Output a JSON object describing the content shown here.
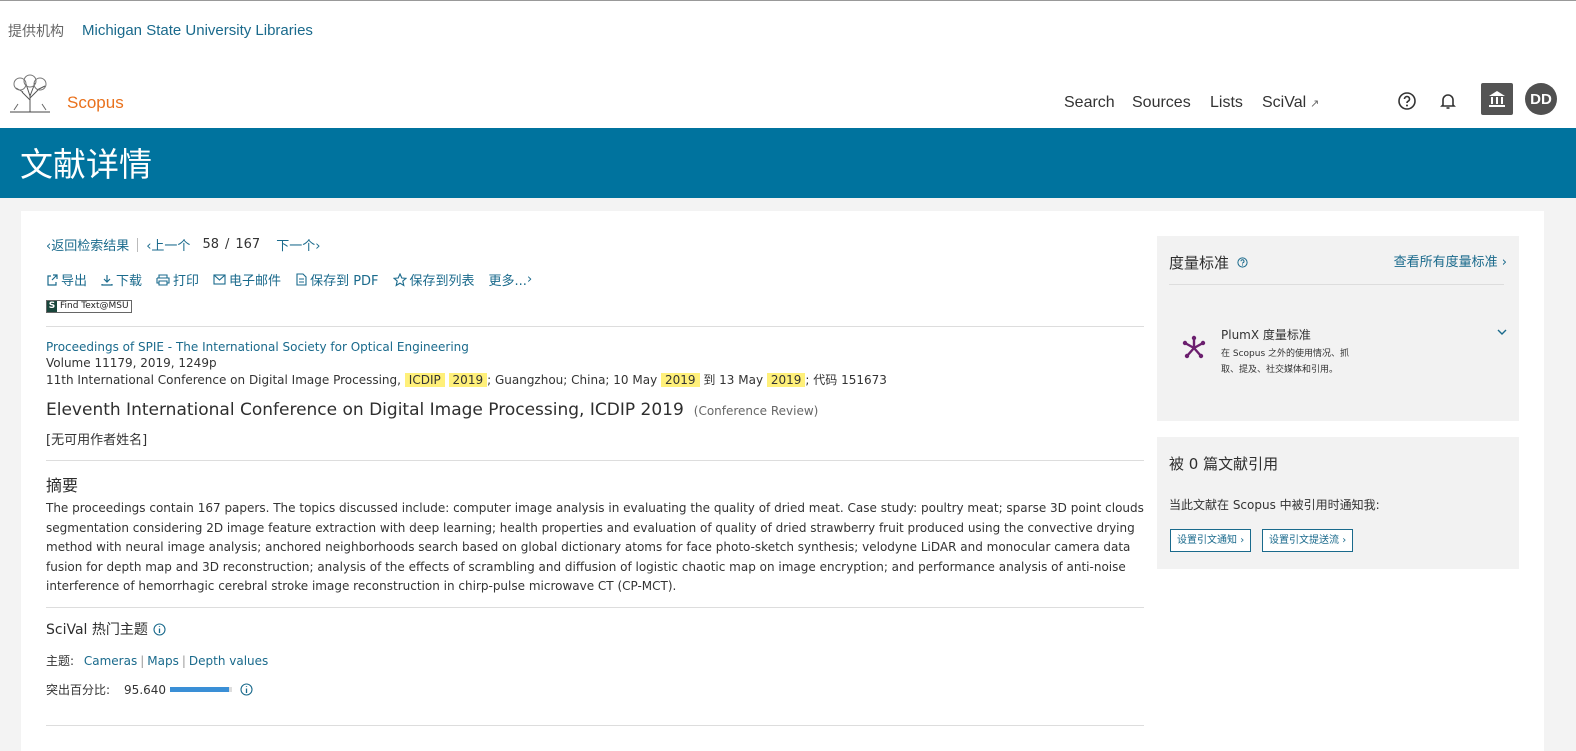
{
  "institution": {
    "label": "提供机构",
    "name": "Michigan State University Libraries"
  },
  "brand": {
    "name": "Scopus",
    "color": "#e9711c"
  },
  "nav": {
    "search": "Search",
    "sources": "Sources",
    "lists": "Lists",
    "scival": "SciVal",
    "scival_ext": "↗"
  },
  "user": {
    "initials": "DD"
  },
  "icons": [
    "help-icon",
    "bell-icon",
    "institution-icon",
    "external-link-icon"
  ],
  "banner": {
    "title": "文献详情",
    "color": "#00739e"
  },
  "pager": {
    "back": "返回检索结果",
    "prev": "上一个",
    "current": "58",
    "slash": "/",
    "total": "167",
    "next": "下一个"
  },
  "actions": {
    "export": "导出",
    "download": "下载",
    "print": "打印",
    "email": "电子邮件",
    "save_pdf": "保存到 PDF",
    "save_list": "保存到列表",
    "more": "更多..."
  },
  "findtext": {
    "s": "S",
    "label": "Find Text@MSU"
  },
  "source": {
    "title": "Proceedings of SPIE - The International Society for Optical Engineering",
    "meta": "Volume 11179, 2019, 1249p",
    "conf_a": "11th International Conference on Digital Image Processing, ",
    "hl_icdip": "ICDIP",
    "hl_2019a": "2019",
    "conf_b": "; Guangzhou; China; 10 May ",
    "hl_2019b": "2019",
    "conf_c": " 到 13 May ",
    "hl_2019c": "2019",
    "conf_d": "; 代码 151673"
  },
  "document": {
    "title": "Eleventh International Conference on Digital Image Processing, ICDIP 2019",
    "type": "(Conference Review)",
    "authors": "[无可用作者姓名]"
  },
  "abstract": {
    "heading": "摘要",
    "text": "The proceedings contain 167 papers. The topics discussed include: computer image analysis in evaluating the quality of dried meat. Case study: poultry meat; sparse 3D point clouds segmentation considering 2D image feature extraction with deep learning; health properties and evaluation of quality of dried strawberry fruit produced using the convective drying method with neural image analysis; anchored neighborhoods search based on global dictionary atoms for face photo-sketch synthesis; velodyne LiDAR and monocular camera data fusion for depth map and 3D reconstruction; analysis of the effects of scrambling and diffusion of logistic chaotic map on image encryption; and performance analysis of anti-noise interference of hemorrhagic cerebral stroke image reconstruction in chirp-pulse microwave CT (CP-MCT)."
  },
  "scival": {
    "heading": "SciVal 热门主题",
    "topics_label": "主题:",
    "topics": [
      "Cameras",
      "Maps",
      "Depth values"
    ],
    "prominence_label": "突出百分比:",
    "prominence_value": "95.640",
    "prominence_fraction": 0.9564
  },
  "metrics": {
    "heading": "度量标准",
    "view_all": "查看所有度量标准",
    "plumx_title": "PlumX 度量标准",
    "plumx_desc": "在 Scopus 之外的使用情况、抓取、提及、社交媒体和引用。"
  },
  "citations": {
    "heading": "被 0 篇文献引用",
    "notify": "当此文献在 Scopus 中被引用时通知我:",
    "btn_alert": "设置引文通知",
    "btn_feed": "设置引文提送流"
  }
}
